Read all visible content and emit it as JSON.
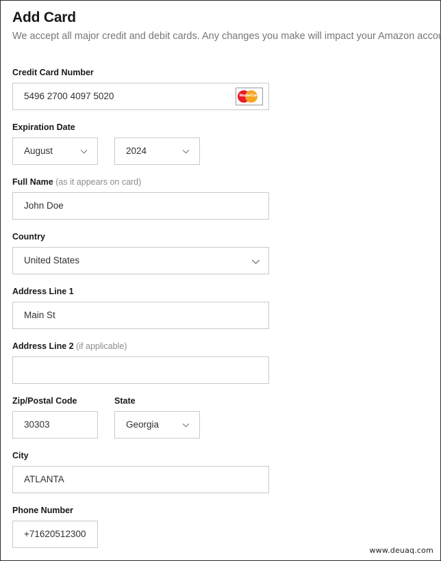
{
  "header": {
    "title": "Add Card",
    "subtitle": "We accept all major credit and debit cards. Any changes you make will impact your Amazon account."
  },
  "fields": {
    "card_number": {
      "label": "Credit Card Number",
      "value": "5496 2700 4097 5020",
      "brand": "MasterCard",
      "brand_icon": "mastercard-icon"
    },
    "expiration": {
      "label": "Expiration Date",
      "month": "August",
      "year": "2024"
    },
    "full_name": {
      "label": "Full Name",
      "hint": "(as it appears on card)",
      "value": "John Doe"
    },
    "country": {
      "label": "Country",
      "value": "United States"
    },
    "address1": {
      "label": "Address Line 1",
      "value": "Main St"
    },
    "address2": {
      "label": "Address Line 2",
      "hint": "(if applicable)",
      "value": ""
    },
    "zip": {
      "label": "Zip/Postal Code",
      "value": "30303"
    },
    "state": {
      "label": "State",
      "value": "Georgia"
    },
    "city": {
      "label": "City",
      "value": "ATLANTA"
    },
    "phone": {
      "label": "Phone Number",
      "value": "+71620512300"
    }
  },
  "watermark": "www.deuaq.com",
  "colors": {
    "text": "#16181a",
    "muted": "#767676",
    "border": "#c9c9c9",
    "brand_red": "#e81c2a",
    "brand_orange": "#f5a623"
  }
}
